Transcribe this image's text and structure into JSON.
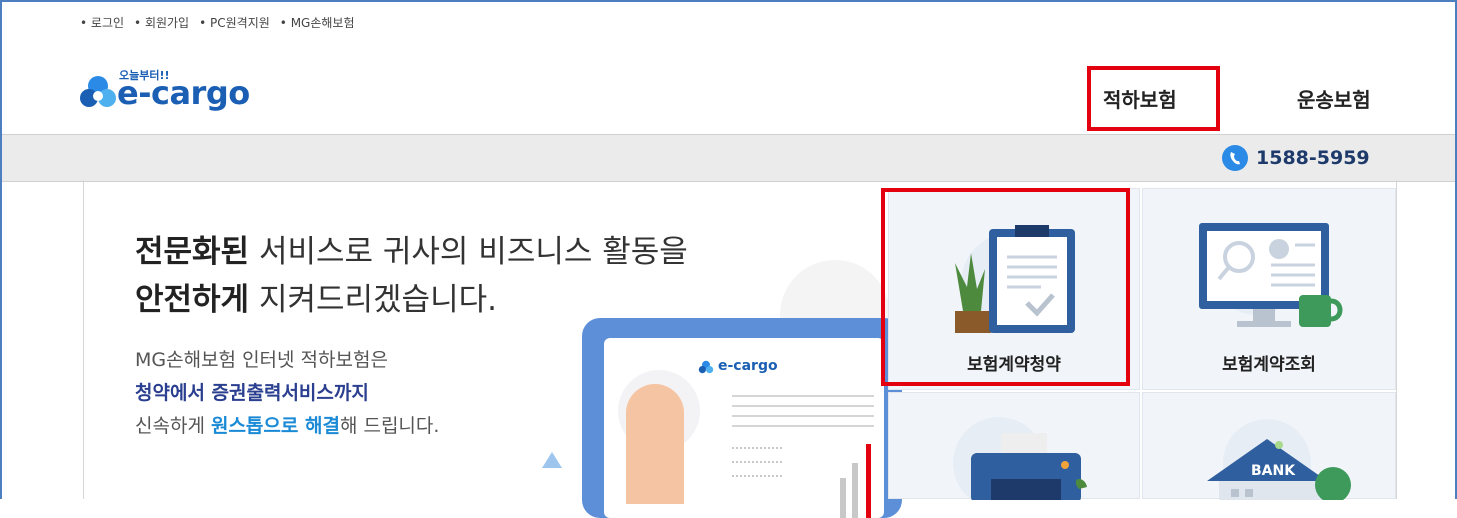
{
  "util_links": [
    "로그인",
    "회원가입",
    "PC원격지원",
    "MG손해보험"
  ],
  "logo": {
    "tagline": "오늘부터!!",
    "name": "e-cargo"
  },
  "nav": {
    "item1": "적하보험",
    "item2": "운송보험"
  },
  "phone": "1588-5959",
  "headline": {
    "line1_bold": "전문화된",
    "line1_rest": " 서비스로 귀사의 비즈니스 활동을",
    "line2_bold": "안전하게",
    "line2_rest": " 지켜드리겠습니다."
  },
  "desc": {
    "line1": "MG손해보험 인터넷 적하보험은",
    "line2": "청약에서 증권출력서비스까지",
    "line3_pre": "신속하게 ",
    "line3_hl": "원스톱으로 해결",
    "line3_post": "해 드립니다."
  },
  "tiles": {
    "tile1": "보험계약청약",
    "tile2": "보험계약조회"
  },
  "colors": {
    "brand": "#1a5fb4",
    "highlight": "#e3000f",
    "bar": "#ebebeb"
  }
}
